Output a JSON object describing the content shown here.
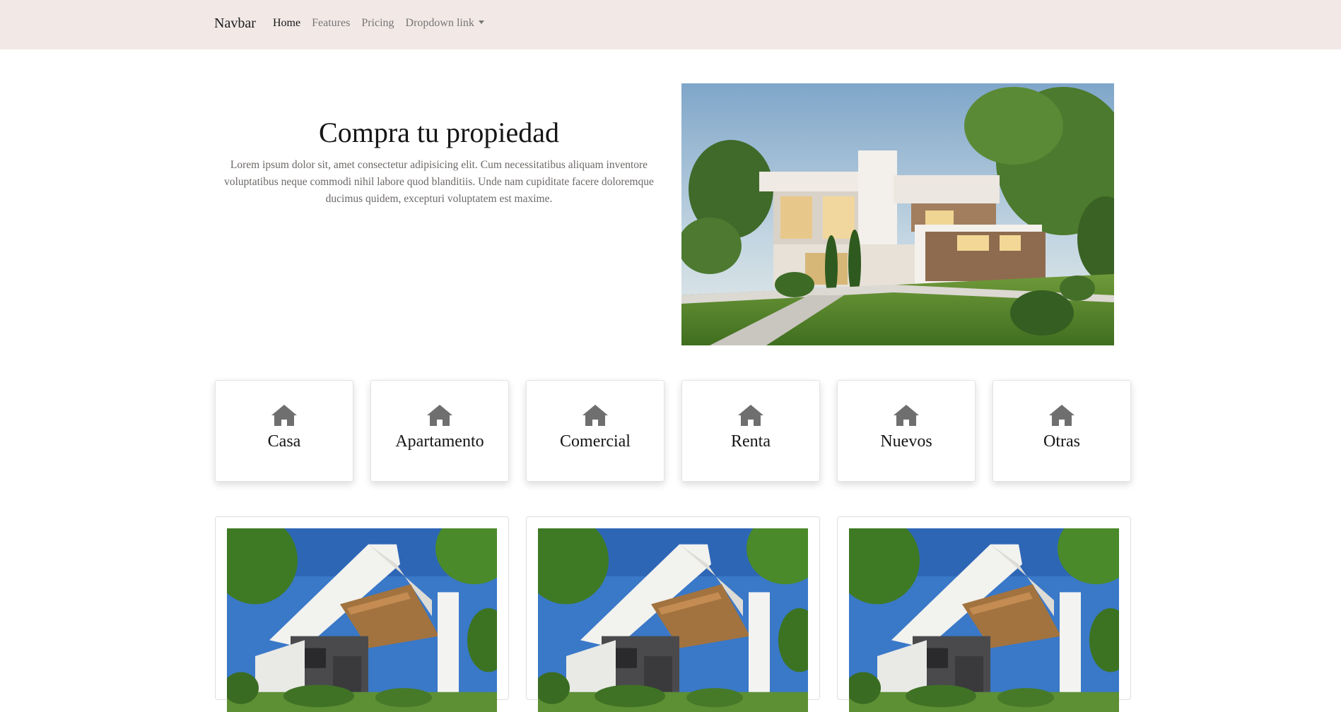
{
  "navbar": {
    "brand": "Navbar",
    "links": [
      {
        "label": "Home",
        "active": true
      },
      {
        "label": "Features",
        "active": false
      },
      {
        "label": "Pricing",
        "active": false
      },
      {
        "label": "Dropdown link",
        "active": false,
        "dropdown": true
      }
    ],
    "background": "#f2e9e7"
  },
  "hero": {
    "title": "Compra tu propiedad",
    "text": "Lorem ipsum dolor sit, amet consectetur adipisicing elit. Cum necessitatibus aliquam inventore voluptatibus neque commodi nihil labore quod blanditiis. Unde nam cupiditate facere doloremque ducimus quidem, excepturi voluptatem est maxime.",
    "image_icon": "modern-house-photo"
  },
  "categories": [
    {
      "icon": "house-icon",
      "label": "Casa"
    },
    {
      "icon": "house-icon",
      "label": "Apartamento"
    },
    {
      "icon": "house-icon",
      "label": "Comercial"
    },
    {
      "icon": "house-icon",
      "label": "Renta"
    },
    {
      "icon": "house-icon",
      "label": "Nuevos"
    },
    {
      "icon": "house-icon",
      "label": "Otras"
    }
  ],
  "properties": [
    {
      "image_icon": "modern-house-photo"
    },
    {
      "image_icon": "modern-house-photo"
    },
    {
      "image_icon": "modern-house-photo"
    }
  ],
  "colors": {
    "icon_gray": "#6f6f6f",
    "text_muted": "#6c6866"
  }
}
